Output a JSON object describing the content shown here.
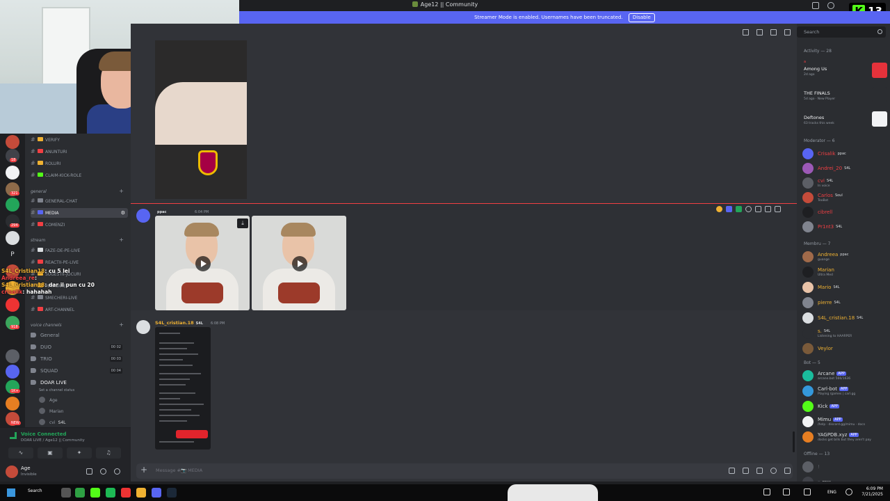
{
  "window": {
    "title": "Age12 || Community"
  },
  "streamer_mode": {
    "text": "Streamer Mode is enabled. Usernames have been truncated.",
    "button": "Disable"
  },
  "kick": {
    "letter": "K",
    "count": "13"
  },
  "servers": {
    "badges": [
      "18",
      "321",
      "294",
      "1",
      "918",
      "1K+",
      "NEW"
    ],
    "letter": "P"
  },
  "channels": {
    "top": [
      {
        "name": "VERIFY",
        "emoji_color": "#f0b232"
      },
      {
        "name": "ANUNTURI",
        "emoji_color": "#f23f43"
      },
      {
        "name": "ROLURI",
        "emoji_color": "#f0b232"
      },
      {
        "name": "CLAIM-KICK-ROLE",
        "emoji_color": "#53fc18"
      }
    ],
    "general_category": "general",
    "general": [
      {
        "name": "GENERAL-CHAT",
        "emoji_color": "#80848e"
      },
      {
        "name": "MEDIA",
        "emoji_color": "#5865f2"
      },
      {
        "name": "COMENZI",
        "emoji_color": "#f23f43"
      }
    ],
    "stream_category": "stream",
    "stream": [
      {
        "name": "FAZE-DE-PE-LIVE",
        "emoji_color": "#dbdee1"
      },
      {
        "name": "REACTII-PE-LIVE",
        "emoji_color": "#f23f43"
      },
      {
        "name": "SUGESTII-JOCURI",
        "emoji_color": "#f0b232"
      },
      {
        "name": "MANCARE",
        "emoji_color": "#f0b232"
      },
      {
        "name": "SMECHERI-LIVE",
        "emoji_color": "#80848e"
      },
      {
        "name": "ART-CHANNEL",
        "emoji_color": "#f23f43"
      }
    ],
    "voice_category": "voice channels",
    "voice": [
      {
        "name": "General",
        "count": ""
      },
      {
        "name": "DUO",
        "count": "00 02"
      },
      {
        "name": "TRIO",
        "count": "00 03"
      },
      {
        "name": "SQUAD",
        "count": "00 04"
      }
    ],
    "live_channel": "DOAR LIVE",
    "live_status": "Set a channel status",
    "voice_users": [
      "Age",
      "Marian",
      "cvi"
    ],
    "voice_user_tag": "S4L"
  },
  "overlay_chat": [
    {
      "user": "S4L_Cristian18",
      "color": "#f0b232",
      "text": ": cu 5 lei"
    },
    {
      "user": "Andreea_re",
      "color": "#f23f43",
      "text": ":"
    },
    {
      "user": "S4L_Cristian18",
      "color": "#f0b232",
      "text": ": dar il pun cu 20"
    },
    {
      "user": "crisalik",
      "color": "#f23f43",
      "text": ": hahahah"
    }
  ],
  "voice_panel": {
    "title": "Voice Connected",
    "subtitle": "DOAR LIVE / Age12 || Community"
  },
  "user_panel": {
    "name": "Age",
    "status": "Invisible"
  },
  "chat": {
    "messages": [
      {
        "user": "",
        "tag": "ppac",
        "time": "6:04 PM",
        "color": "#f23f43"
      },
      {
        "user": "S4L_cristian.18",
        "tag": "S4L",
        "time": "6:08 PM",
        "color": "#f0b232"
      }
    ],
    "composer_placeholder": "Message #📷 MEDIA"
  },
  "search": {
    "placeholder": "Search"
  },
  "activity": {
    "header": "Activity — 28",
    "items": [
      {
        "who": "a",
        "title": "Among Us",
        "sub": "2d ago",
        "art": "#e5323b"
      },
      {
        "who": "",
        "title": "THE FINALS",
        "sub": "5d ago  ·  New Player",
        "art": "#2b2d31"
      },
      {
        "who": "",
        "title": "Deftones",
        "sub": "63 tracks this week",
        "art": "#f2f3f5"
      }
    ]
  },
  "members": {
    "moderator_header": "Moderator — 6",
    "moderators": [
      {
        "name": "Crisalik",
        "tag": "ppac",
        "sub": "",
        "color": "#f23f43",
        "avatar": "#5865f2"
      },
      {
        "name": "Andrei_20",
        "tag": "S4L",
        "sub": "",
        "color": "#f23f43",
        "avatar": "#9c59b6"
      },
      {
        "name": "cvi",
        "tag": "S4L",
        "sub": "In voice",
        "color": "#f23f43",
        "avatar": "#5c5f66"
      },
      {
        "name": "Carlos",
        "tag": "Soul",
        "sub": "TeoBot",
        "color": "#f23f43",
        "avatar": "#c44b3a"
      },
      {
        "name": "cibrell",
        "tag": "",
        "sub": "",
        "color": "#f23f43",
        "avatar": "#1e1f22"
      },
      {
        "name": "Pr1nt3",
        "tag": "S4L",
        "sub": "",
        "color": "#f23f43",
        "avatar": "#80848e"
      }
    ],
    "member_header": "Membru — 7",
    "membrii": [
      {
        "name": "Andreea",
        "tag": "ppac",
        "sub": "guange",
        "color": "#f0b232",
        "avatar": "#a06a4a"
      },
      {
        "name": "Marian",
        "tag": "",
        "sub": "Ultra Med",
        "color": "#f0b232",
        "avatar": "#1e1f22"
      },
      {
        "name": "Mario",
        "tag": "S4L",
        "sub": "",
        "color": "#f0b232",
        "avatar": "#e9c3a8"
      },
      {
        "name": "pierre",
        "tag": "S4L",
        "sub": "",
        "color": "#f0b232",
        "avatar": "#80848e"
      },
      {
        "name": "S4L_cristian.18",
        "tag": "S4L",
        "sub": "",
        "color": "#f0b232",
        "avatar": "#dbdee1"
      },
      {
        "name": "s.",
        "tag": "S4L",
        "sub": "Listening to HAARPER",
        "color": "#f0b232",
        "avatar": "#2b2d31"
      },
      {
        "name": "Veylor",
        "tag": "",
        "sub": "",
        "color": "#f0b232",
        "avatar": "#7a5a3a"
      }
    ],
    "bot_header": "Bot — 5",
    "bots": [
      {
        "name": "Arcane",
        "tag": "APP",
        "sub": "arcane.bot 566/1636",
        "color": "#dbdee1",
        "avatar": "#1abc9c"
      },
      {
        "name": "Carl-bot",
        "tag": "APP",
        "sub": "Playing /games | carl.gg",
        "color": "#dbdee1",
        "avatar": "#3498db"
      },
      {
        "name": "Kick",
        "tag": "APP",
        "sub": "",
        "color": "#dbdee1",
        "avatar": "#53fc18"
      },
      {
        "name": "Mimu",
        "tag": "APP",
        "sub": "/help · discord.gg/mimu · docs",
        "color": "#dbdee1",
        "avatar": "#f2f3f5"
      },
      {
        "name": "YAGPDB.xyz",
        "tag": "APP",
        "sub": "docks get bills but they aren't pay",
        "color": "#dbdee1",
        "avatar": "#e67e22"
      }
    ],
    "offline_header": "Offline — 13",
    "offline": [
      {
        "name": "!",
        "tag": "",
        "sub": "",
        "color": "#5c5f66",
        "avatar": "#5c5f66"
      },
      {
        "name": "s",
        "tag": "ppac",
        "sub": "",
        "color": "#5c5f66",
        "avatar": "#404249"
      }
    ]
  },
  "taskbar": {
    "search": "Search",
    "lang": "ENG",
    "time": "6:09 PM",
    "date": "7/21/2025"
  }
}
